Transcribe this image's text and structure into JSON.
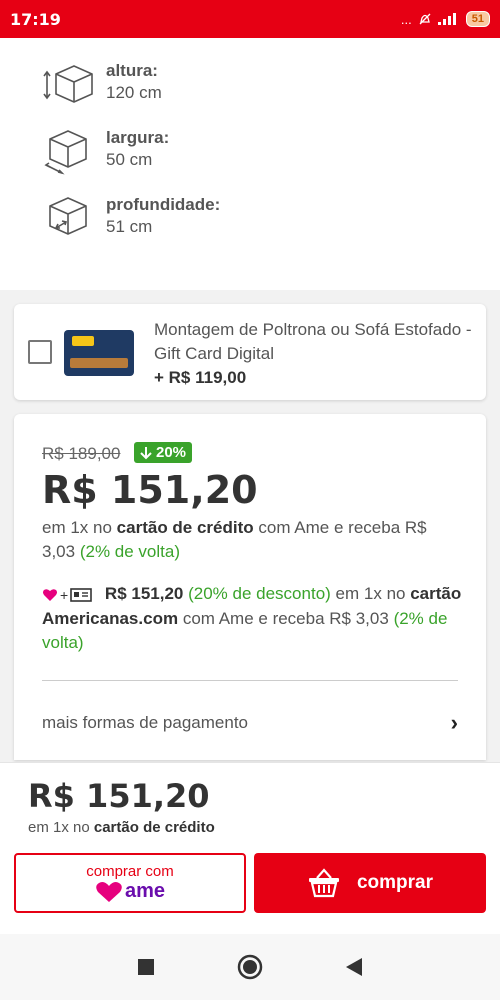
{
  "status_bar": {
    "time": "17:19",
    "indicators": "...",
    "battery": "51"
  },
  "dimensions": [
    {
      "label": "altura:",
      "value": "120 cm",
      "icon": "height-box-icon"
    },
    {
      "label": "largura:",
      "value": "50 cm",
      "icon": "width-box-icon"
    },
    {
      "label": "profundidade:",
      "value": "51 cm",
      "icon": "depth-box-icon"
    }
  ],
  "montage": {
    "title": "Montagem de Poltrona ou Sofá Estofado - Gift Card Digital",
    "price": "+ R$ 119,00",
    "checked": false
  },
  "price_card": {
    "old_price": "R$ 189,00",
    "discount": "20%",
    "price": "R$ 151,20",
    "credit_prefix": "em 1x no",
    "credit_bold": "cartão de crédito",
    "credit_mid": "com Ame e receba R$ 3,03",
    "credit_cashback": "(2% de volta)",
    "ame_price": "R$ 151,20",
    "ame_discount": "(20% de desconto)",
    "ame_mid": "em 1x no",
    "ame_card": "cartão Americanas.com",
    "ame_tail": "com Ame e receba R$ 3,03",
    "ame_cashback": "(2% de volta)",
    "more_payments": "mais formas de pagamento"
  },
  "bottom": {
    "price": "R$ 151,20",
    "terms_prefix": "em 1x no",
    "terms_bold": "cartão de crédito",
    "ame_button_top": "comprar com",
    "ame_button_logo": "ame",
    "buy_label": "comprar"
  },
  "colors": {
    "brand_red": "#e60014",
    "green": "#3aa32b",
    "ame_purple": "#6a0dad",
    "ame_pink": "#e6007e"
  }
}
